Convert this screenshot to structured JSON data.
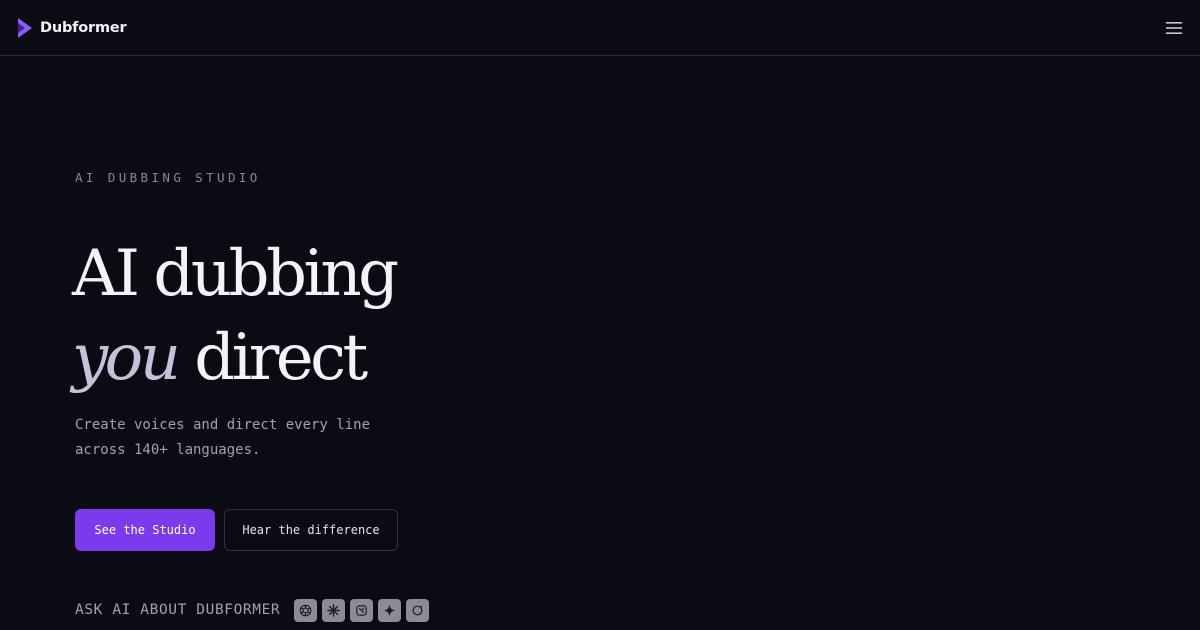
{
  "header": {
    "brand_name": "Dubformer",
    "menu_icon": "hamburger-menu-icon"
  },
  "hero": {
    "eyebrow": "AI DUBBING STUDIO",
    "title_line1": "AI dubbing",
    "title_line2_italic": "you",
    "title_line2_rest": "direct",
    "subtitle": "Create voices and direct every line across 140+ languages."
  },
  "actions": {
    "primary_label": "See the Studio",
    "secondary_label": "Hear the difference"
  },
  "ask_ai": {
    "label": "ASK AI ABOUT DUBFORMER",
    "icons": [
      "chatgpt-icon",
      "claude-icon",
      "grok-icon",
      "gemini-icon",
      "perplexity-icon"
    ]
  },
  "colors": {
    "background": "#0c0b14",
    "accent": "#7c3aed",
    "text": "#f4f3f8",
    "muted_text": "#a3a0ad",
    "border": "#2a2933"
  }
}
